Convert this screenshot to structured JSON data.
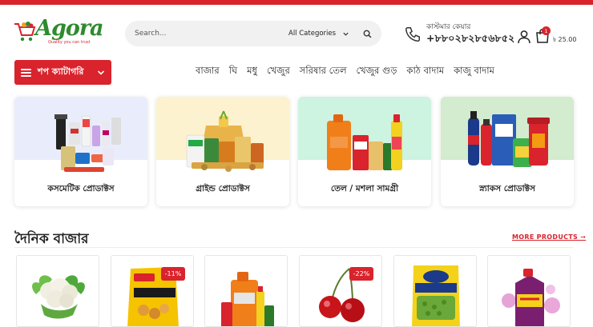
{
  "brand": {
    "name": "Agora",
    "tagline": "Quality you can trust"
  },
  "search": {
    "placeholder": "Search...",
    "category": "All Categories"
  },
  "support": {
    "label": "কাস্টমার কেয়ার",
    "phone": "+৮৮০২৮২৮৫৬৮৫২"
  },
  "cart": {
    "count": "1",
    "total": "৳ 25.00"
  },
  "category_button": "শপ ক্যাটাগরি",
  "nav": [
    "বাজার",
    "ঘি",
    "মধু",
    "খেজুর",
    "সরিষার তেল",
    "খেজুর গুড়",
    "কাঠ বাদাম",
    "কাজু বাদাম"
  ],
  "categories": [
    {
      "label": "কসমেটিক প্রোডাক্টস",
      "bg": "#e9edfb"
    },
    {
      "label": "গ্রাইন্ড প্রোডাক্টস",
      "bg": "#fdf2cf"
    },
    {
      "label": "তেল / মশলা সামগ্রী",
      "bg": "#cdf3e1"
    },
    {
      "label": "স্ন্যাকস প্রোডাক্টস",
      "bg": "#d3ebce"
    }
  ],
  "section": {
    "title": "দৈনিক বাজার",
    "more": "MORE PRODUCTS ➞"
  },
  "products": [
    {
      "name": "cauliflower",
      "discount": ""
    },
    {
      "name": "mccain-roast",
      "discount": "-11%"
    },
    {
      "name": "oil-and-spices",
      "discount": ""
    },
    {
      "name": "cherry",
      "discount": "-22%"
    },
    {
      "name": "australian-peas",
      "discount": ""
    },
    {
      "name": "xtra-bottle",
      "discount": ""
    }
  ],
  "colors": {
    "accent": "#d9232d",
    "brand_green": "#2e8b2e"
  }
}
